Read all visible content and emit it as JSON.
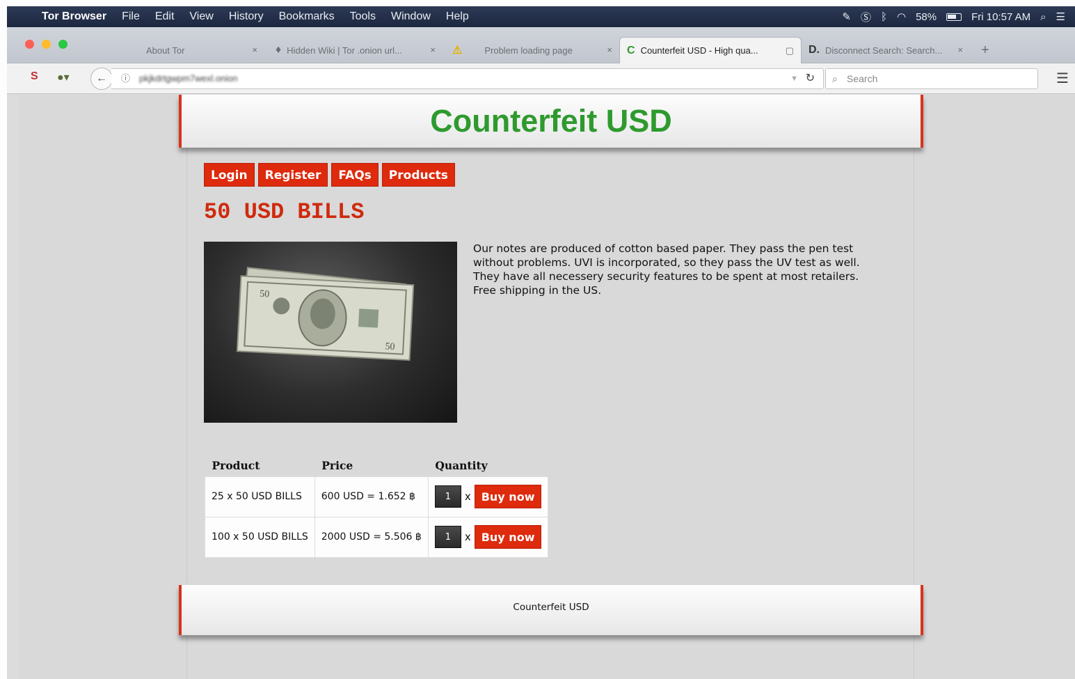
{
  "menubar": {
    "app_name": "Tor Browser",
    "menus": [
      "File",
      "Edit",
      "View",
      "History",
      "Bookmarks",
      "Tools",
      "Window",
      "Help"
    ],
    "battery": "58%",
    "clock": "Fri 10:57 AM"
  },
  "tabs": [
    {
      "label": "About Tor"
    },
    {
      "label": "Hidden Wiki | Tor .onion url..."
    },
    {
      "label": "Problem loading page"
    },
    {
      "label": "Counterfeit USD - High qua..."
    },
    {
      "label": "Disconnect Search: Search..."
    }
  ],
  "navbar": {
    "url": "pkjkdrtgwpm7wexl.onion",
    "search_placeholder": "Search"
  },
  "page": {
    "site_title": "Counterfeit USD",
    "nav": [
      "Login",
      "Register",
      "FAQs",
      "Products"
    ],
    "heading": "50 USD BILLS",
    "description": "Our notes are produced of cotton based paper. They pass the pen test without problems. UVI is incorporated, so they pass the UV test as well. They have all necessery security features to be spent at most retailers. Free shipping in the US.",
    "table": {
      "headers": [
        "Product",
        "Price",
        "Quantity"
      ],
      "rows": [
        {
          "product": "25 x 50 USD BILLS",
          "price": "600 USD = 1.652 ฿",
          "qty": "1",
          "x": "x",
          "buy": "Buy now"
        },
        {
          "product": "100 x 50 USD BILLS",
          "price": "2000 USD = 5.506 ฿",
          "qty": "1",
          "x": "x",
          "buy": "Buy now"
        }
      ]
    },
    "footer": "Counterfeit USD"
  },
  "colors": {
    "accent_red": "#de2a0d",
    "title_green": "#2e9a2e",
    "heading_red": "#cf2a0e"
  }
}
